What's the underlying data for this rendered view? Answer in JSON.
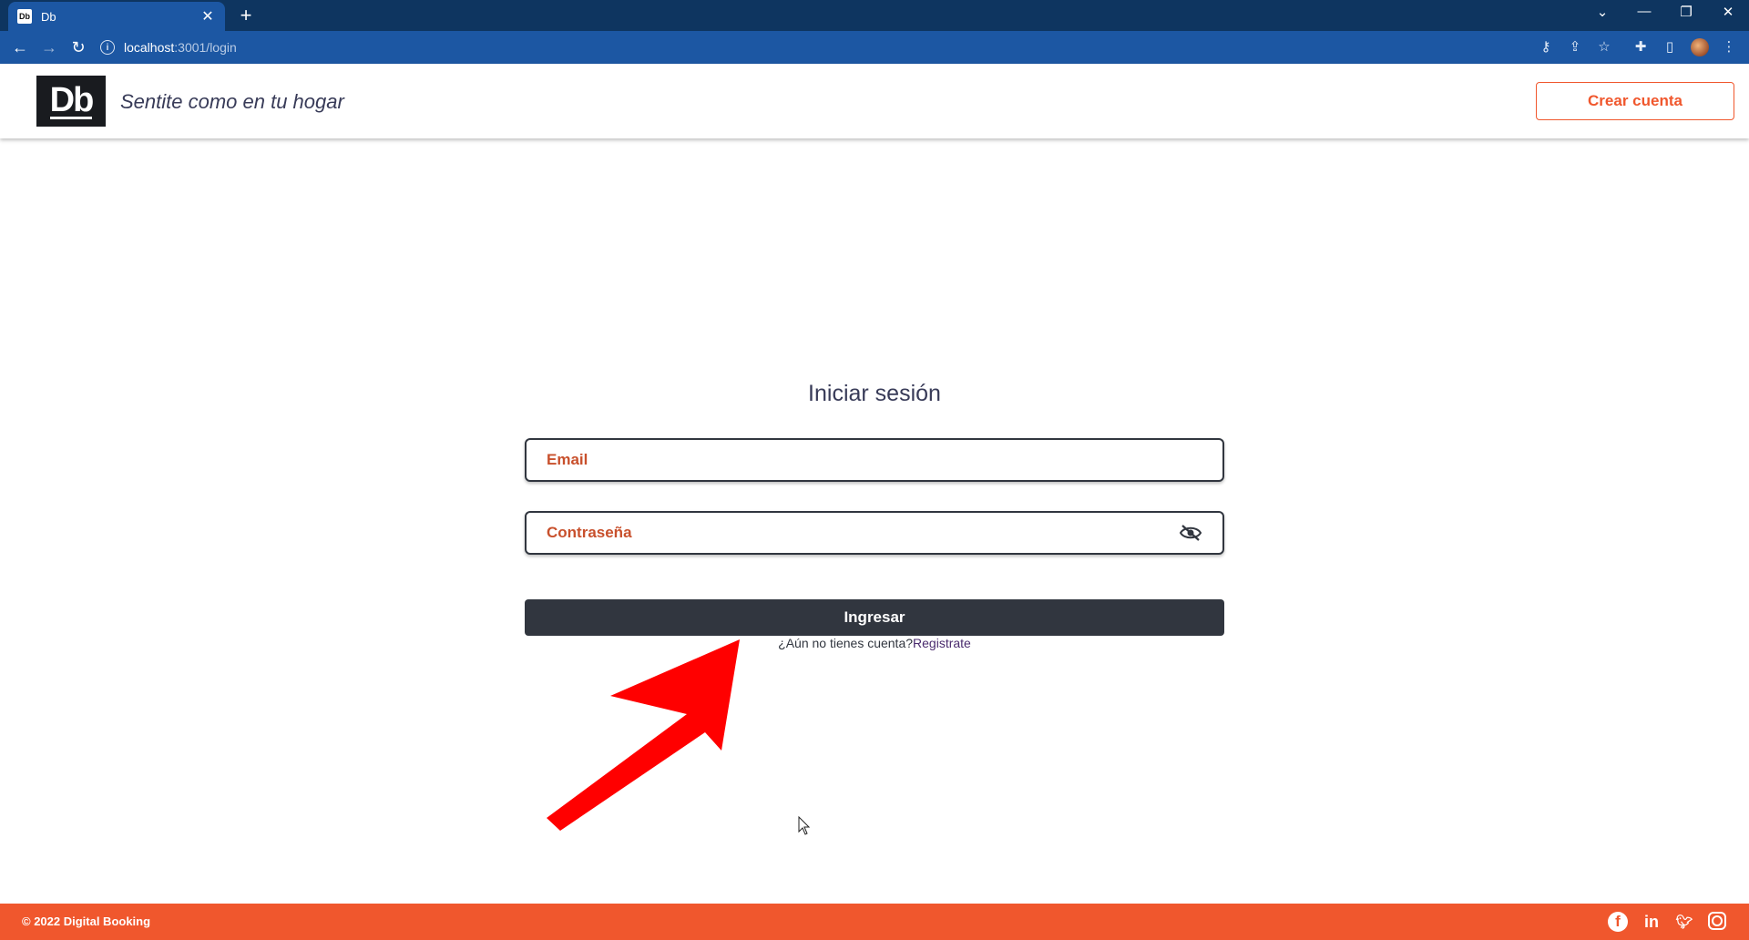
{
  "browser": {
    "tab_title": "Db",
    "tab_favicon_text": "Db",
    "tab_close": "✕",
    "new_tab": "+",
    "url_host": "localhost",
    "url_path": ":3001/login",
    "window_controls": [
      "⌄",
      "—",
      "❐",
      "✕"
    ]
  },
  "header": {
    "logo": "Db",
    "slogan": "Sentite como en tu hogar",
    "create_account": "Crear cuenta"
  },
  "login": {
    "title": "Iniciar sesión",
    "email_placeholder": "Email",
    "password_placeholder": "Contraseña",
    "submit": "Ingresar",
    "no_account": "¿Aún no tienes cuenta?",
    "register_link": "Registrate"
  },
  "footer": {
    "copyright": "© 2022 Digital Booking",
    "social": [
      "facebook-icon",
      "linkedin-icon",
      "twitter-icon",
      "instagram-icon"
    ]
  },
  "colors": {
    "brand_orange": "#f0572d",
    "dark": "#31363f",
    "browser_blue": "#1c57a3"
  }
}
